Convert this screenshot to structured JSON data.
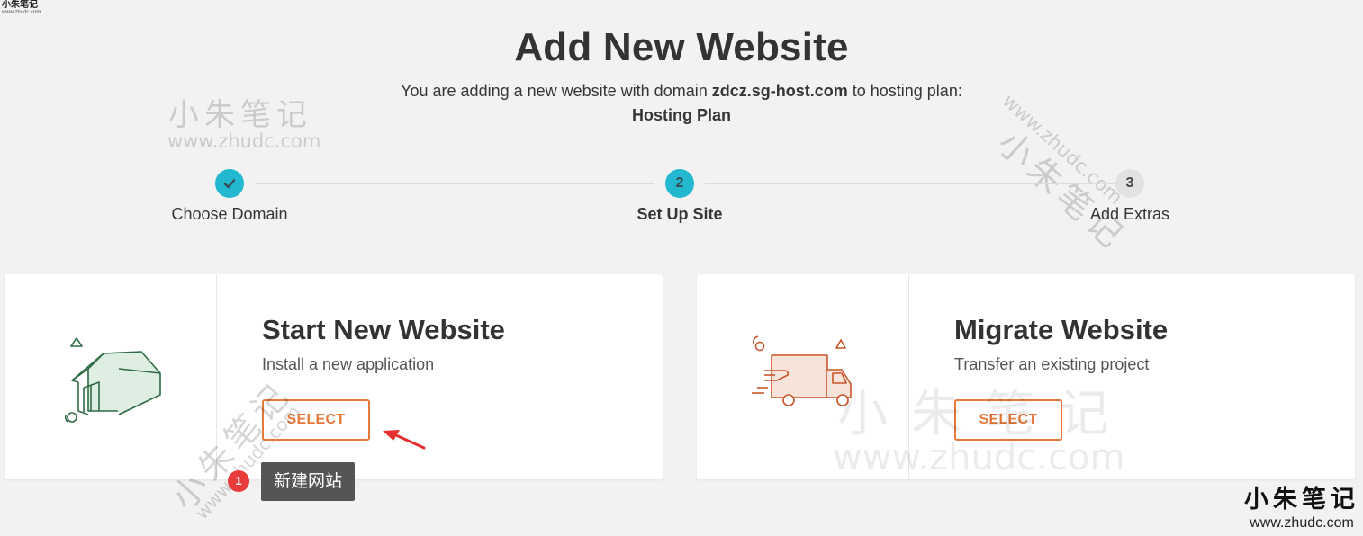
{
  "watermark": {
    "corner_cn": "小朱笔记",
    "corner_url": "www.zhudc.com",
    "cn": "小朱笔记",
    "url": "www.zhudc.com"
  },
  "header": {
    "title": "Add New Website",
    "subtitle_prefix": "You are adding a new website with domain ",
    "domain": "zdcz.sg-host.com",
    "subtitle_middle": " to hosting plan:",
    "plan": "Hosting Plan"
  },
  "stepper": {
    "steps": [
      {
        "label": "Choose Domain",
        "marker": "✔",
        "state": "done"
      },
      {
        "label": "Set Up Site",
        "marker": "2",
        "state": "active"
      },
      {
        "label": "Add Extras",
        "marker": "3",
        "state": "todo"
      }
    ]
  },
  "cards": [
    {
      "title": "Start New Website",
      "desc": "Install a new application",
      "button": "SELECT",
      "icon": "house-icon"
    },
    {
      "title": "Migrate Website",
      "desc": "Transfer an existing project",
      "button": "SELECT",
      "icon": "truck-icon"
    }
  ],
  "annotation": {
    "badge": "1",
    "tooltip": "新建网站"
  },
  "colors": {
    "accent": "#e6783b",
    "step": "#22b8cf",
    "house": "#2e6b45",
    "truck": "#c9552a"
  }
}
